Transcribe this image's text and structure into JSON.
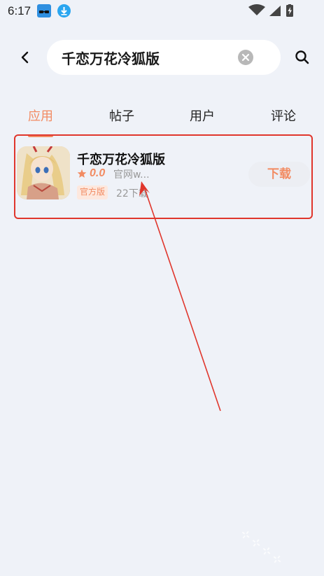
{
  "status_bar": {
    "time": "6:17",
    "icons": [
      "magic-notification-icon",
      "download-notification-icon",
      "wifi-icon",
      "signal-icon",
      "battery-charging-icon"
    ]
  },
  "header": {
    "search_value": "千恋万花冷狐版",
    "icons": [
      "back-icon",
      "clear-icon",
      "search-icon"
    ]
  },
  "tabs": [
    {
      "label": "应用",
      "active": true
    },
    {
      "label": "帖子",
      "active": false
    },
    {
      "label": "用户",
      "active": false
    },
    {
      "label": "评论",
      "active": false
    }
  ],
  "result": {
    "name": "千恋万花冷狐版",
    "rating": "0.0",
    "source": "官网w...",
    "badge": "官方版",
    "downloads": "22下载",
    "download_label": "下载"
  },
  "colors": {
    "accent": "#f28b62",
    "annotation": "#e0362c",
    "background": "#eff2f8"
  }
}
